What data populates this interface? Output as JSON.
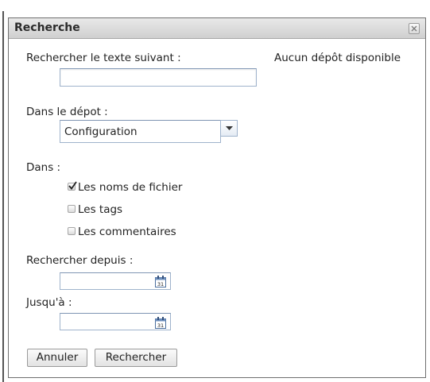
{
  "dialog": {
    "title": "Recherche"
  },
  "form": {
    "search_text_label": "Rechercher le texte suivant :",
    "search_text_value": "",
    "no_repo_message": "Aucun dépôt disponible",
    "repo_label": "Dans le dépot :",
    "repo_selected": "Configuration",
    "scope_label": "Dans :",
    "scope_options": [
      {
        "label": "Les noms de fichier",
        "checked": true
      },
      {
        "label": "Les tags",
        "checked": false
      },
      {
        "label": "Les commentaires",
        "checked": false
      }
    ],
    "from_label": "Rechercher depuis :",
    "from_value": "",
    "to_label": "Jusqu'à :",
    "to_value": "",
    "calendar_icon_text": "31"
  },
  "actions": {
    "cancel_label": "Annuler",
    "search_label": "Rechercher"
  },
  "icons": {
    "close": "close-icon",
    "dropdown": "chevron-down-icon",
    "calendar": "calendar-icon",
    "checkmark": "checkmark-icon"
  }
}
